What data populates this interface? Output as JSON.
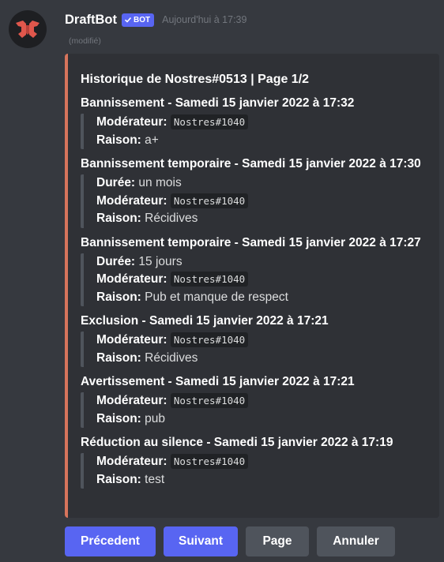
{
  "message": {
    "author": "DraftBot",
    "bot_tag": "BOT",
    "timestamp": "Aujourd'hui à 17:39",
    "edited": "(modifié)"
  },
  "embed": {
    "accent_color": "#d7745c",
    "title": "Historique de Nostres#0513 | Page 1/2",
    "entries": [
      {
        "title": "Bannissement - Samedi 15 janvier 2022 à 17:32",
        "moderator_label": "Modérateur:",
        "moderator": "Nostres#1040",
        "reason_label": "Raison:",
        "reason": "a+"
      },
      {
        "title": "Bannissement temporaire - Samedi 15 janvier 2022 à 17:30",
        "duration_label": "Durée:",
        "duration": "un mois",
        "moderator_label": "Modérateur:",
        "moderator": "Nostres#1040",
        "reason_label": "Raison:",
        "reason": "Récidives"
      },
      {
        "title": "Bannissement temporaire - Samedi 15 janvier 2022 à 17:27",
        "duration_label": "Durée:",
        "duration": "15 jours",
        "moderator_label": "Modérateur:",
        "moderator": "Nostres#1040",
        "reason_label": "Raison:",
        "reason": "Pub et manque de respect"
      },
      {
        "title": "Exclusion - Samedi 15 janvier 2022 à 17:21",
        "moderator_label": "Modérateur:",
        "moderator": "Nostres#1040",
        "reason_label": "Raison:",
        "reason": "Récidives"
      },
      {
        "title": "Avertissement - Samedi 15 janvier 2022 à 17:21",
        "moderator_label": "Modérateur:",
        "moderator": "Nostres#1040",
        "reason_label": "Raison:",
        "reason": "pub"
      },
      {
        "title": "Réduction au silence - Samedi 15 janvier 2022 à 17:19",
        "moderator_label": "Modérateur:",
        "moderator": "Nostres#1040",
        "reason_label": "Raison:",
        "reason": "test"
      }
    ]
  },
  "buttons": {
    "previous": "Précedent",
    "next": "Suivant",
    "page": "Page",
    "cancel": "Annuler"
  },
  "colors": {
    "background": "#36393f",
    "embed_background": "#2f3136",
    "primary_button": "#5865f2",
    "secondary_button": "#4f545c"
  }
}
